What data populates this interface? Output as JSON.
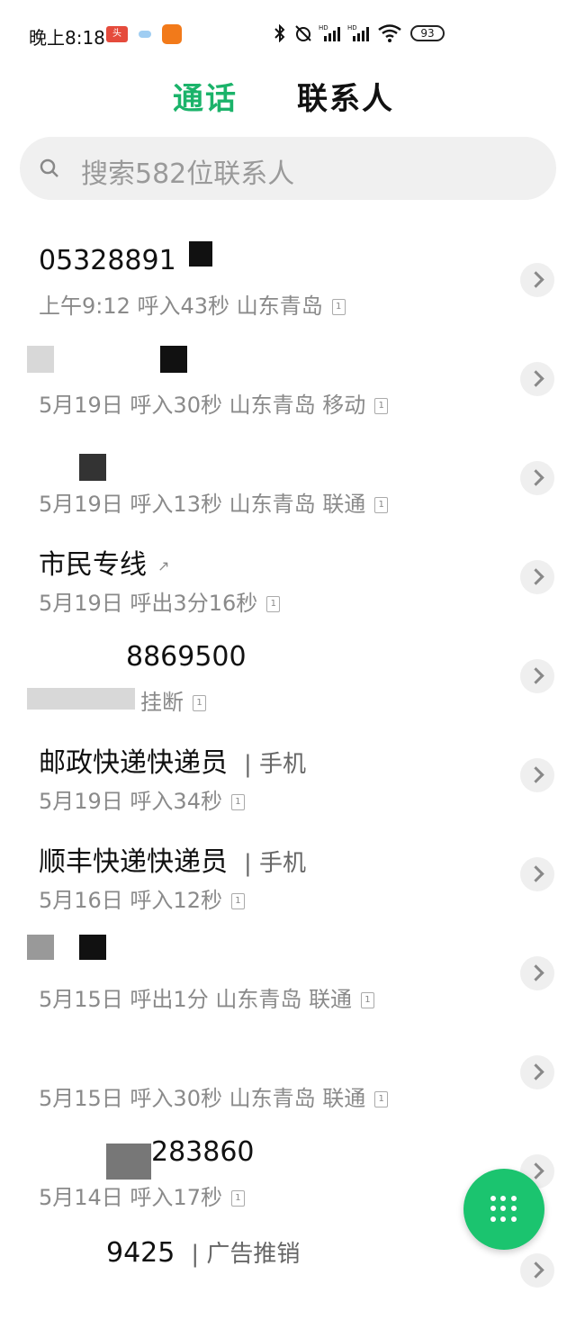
{
  "status": {
    "time": "晚上8:18",
    "battery": "93",
    "left_icons": [
      "toutiao-icon",
      "cloud-icon",
      "app-icon"
    ],
    "right_icons": [
      "bluetooth-icon",
      "alarm-off-icon",
      "hd-signal-icon",
      "hd-signal-icon",
      "wifi-icon"
    ]
  },
  "tabs": [
    {
      "label": "通话",
      "active": true
    },
    {
      "label": "联系人",
      "active": false
    }
  ],
  "search": {
    "placeholder": "搜索582位联系人"
  },
  "calls": [
    {
      "name": "05328891",
      "suffix": "",
      "detail": "上午9:12 呼入43秒 山东青岛"
    },
    {
      "name": "",
      "suffix": "",
      "detail": "5月19日 呼入30秒 山东青岛 移动"
    },
    {
      "name": "",
      "suffix": "",
      "detail": "5月19日 呼入13秒 山东青岛 联通"
    },
    {
      "name": "市民专线",
      "suffix": "",
      "detail": "5月19日 呼出3分16秒"
    },
    {
      "name": "8869500",
      "suffix": "",
      "detail": "挂断"
    },
    {
      "name": "邮政快递快递员",
      "suffix": "| 手机",
      "detail": "5月19日 呼入34秒"
    },
    {
      "name": "顺丰快递快递员",
      "suffix": "| 手机",
      "detail": "5月16日 呼入12秒"
    },
    {
      "name": "",
      "suffix": "",
      "detail": "5月15日 呼出1分 山东青岛 联通"
    },
    {
      "name": "",
      "suffix": "",
      "detail": "5月15日 呼入30秒 山东青岛 联通"
    },
    {
      "name": "283860",
      "suffix": "",
      "detail": "5月14日 呼入17秒"
    },
    {
      "name": "9425",
      "suffix": "| 广告推销",
      "detail": ""
    }
  ],
  "colors": {
    "accent": "#1bb36a",
    "fab": "#1bc46f"
  },
  "fab_icon": "dialpad-icon"
}
